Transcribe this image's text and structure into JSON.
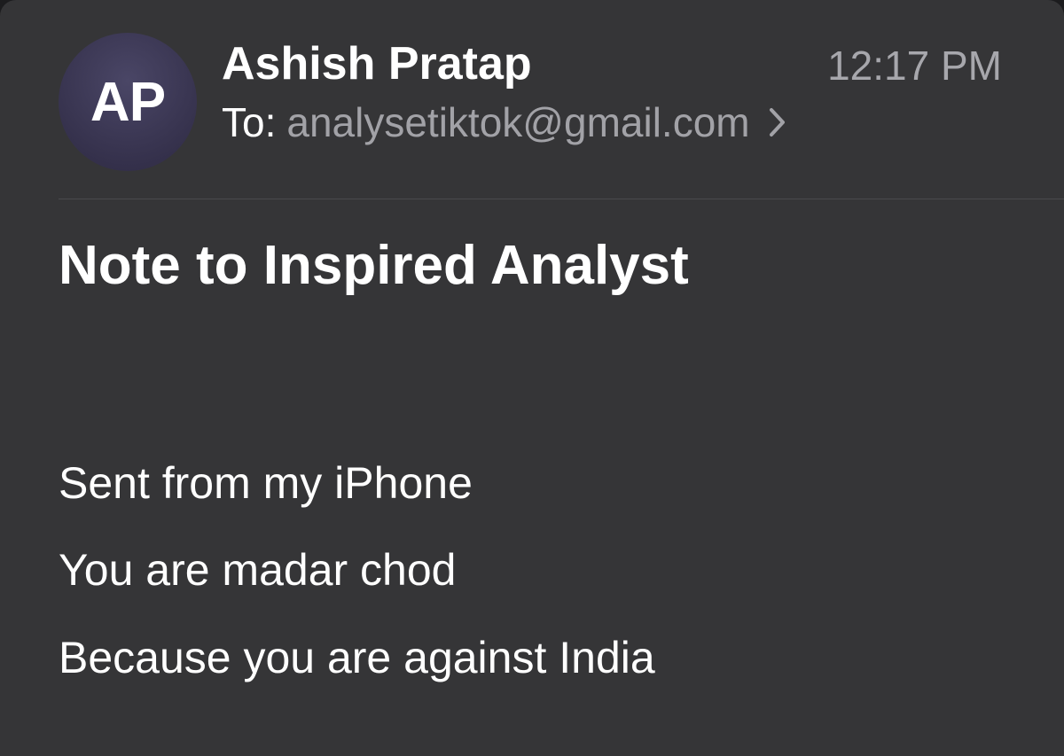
{
  "email": {
    "avatar_initials": "AP",
    "sender_name": "Ashish Pratap",
    "time": "12:17 PM",
    "to_label": "To:",
    "to_address": "analysetiktok@gmail.com",
    "subject": "Note to Inspired Analyst",
    "body_lines": [
      "Sent from my iPhone",
      "You are madar chod",
      "Because you are against India"
    ]
  },
  "icons": {
    "recipient_chevron": "chevron-right-icon"
  },
  "colors": {
    "background": "#353537",
    "primary_text": "#ffffff",
    "secondary_text": "#a2a2a7",
    "avatar": "#3a3652"
  }
}
